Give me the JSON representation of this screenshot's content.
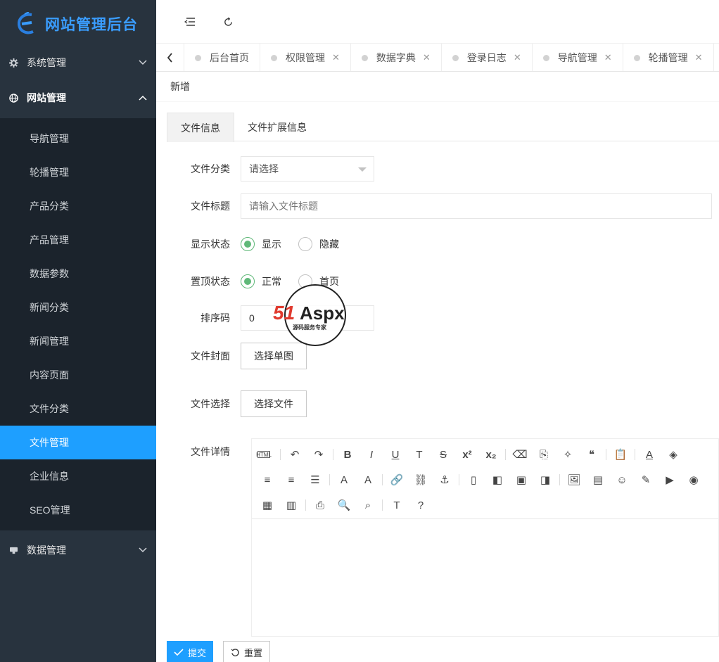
{
  "brand": {
    "title": "网站管理后台",
    "logo_icon": "e-logo-icon",
    "color": "#3a9dff"
  },
  "sidebar": {
    "groups": [
      {
        "label": "系统管理",
        "icon": "gear-icon",
        "open": false
      },
      {
        "label": "网站管理",
        "icon": "globe-icon",
        "open": true
      },
      {
        "label": "数据管理",
        "icon": "database-icon",
        "open": false
      }
    ],
    "items": [
      "导航管理",
      "轮播管理",
      "产品分类",
      "产品管理",
      "数据参数",
      "新闻分类",
      "新闻管理",
      "内容页面",
      "文件分类",
      "文件管理",
      "企业信息",
      "SEO管理"
    ],
    "active_item": "文件管理",
    "colors": {
      "bg": "#28333e",
      "submenu_bg": "#1b232c",
      "active": "#1e9fff"
    }
  },
  "header": {
    "collapse_icon": "menu-fold-icon",
    "refresh_icon": "refresh-icon"
  },
  "tabs": {
    "items": [
      {
        "label": "后台首页",
        "closable": false
      },
      {
        "label": "权限管理",
        "closable": true
      },
      {
        "label": "数据字典",
        "closable": true
      },
      {
        "label": "登录日志",
        "closable": true
      },
      {
        "label": "导航管理",
        "closable": true
      },
      {
        "label": "轮播管理",
        "closable": true
      }
    ],
    "close_glyph": "✕"
  },
  "page": {
    "title": "新增"
  },
  "form_tabs": [
    "文件信息",
    "文件扩展信息"
  ],
  "form": {
    "category_label": "文件分类",
    "category_value": "请选择",
    "title_label": "文件标题",
    "title_placeholder": "请输入文件标题",
    "status_label": "显示状态",
    "status_options": [
      "显示",
      "隐藏"
    ],
    "status_selected": "显示",
    "top_label": "置顶状态",
    "top_options": [
      "正常",
      "首页"
    ],
    "top_selected": "正常",
    "sort_label": "排序码",
    "sort_value": "0",
    "cover_label": "文件封面",
    "cover_button": "选择单图",
    "file_label": "文件选择",
    "file_button": "选择文件",
    "detail_label": "文件详情",
    "accent_color": "#5fb878"
  },
  "editor": {
    "tool_row1": [
      {
        "icon": "html-icon",
        "glyph": "HTML"
      },
      {
        "icon": "undo-icon",
        "glyph": "↶"
      },
      {
        "icon": "redo-icon",
        "glyph": "↷"
      },
      {
        "icon": "bold-icon",
        "glyph": "B"
      },
      {
        "icon": "italic-icon",
        "glyph": "I"
      },
      {
        "icon": "underline-icon",
        "glyph": "U"
      },
      {
        "icon": "textbox-icon",
        "glyph": "T"
      },
      {
        "icon": "strikethrough-icon",
        "glyph": "S"
      },
      {
        "icon": "superscript-icon",
        "glyph": "x²"
      },
      {
        "icon": "subscript-icon",
        "glyph": "x₂"
      },
      {
        "icon": "eraser-icon",
        "glyph": "⌫"
      },
      {
        "icon": "format-painter-icon",
        "glyph": "⎘"
      },
      {
        "icon": "magic-wand-icon",
        "glyph": "✧"
      },
      {
        "icon": "blockquote-icon",
        "glyph": "❝"
      },
      {
        "icon": "paste-icon",
        "glyph": "📋"
      },
      {
        "icon": "font-color-icon",
        "glyph": "A"
      },
      {
        "icon": "bg-color-icon",
        "glyph": "◈"
      }
    ],
    "tool_row2": [
      {
        "icon": "align-center-icon",
        "glyph": "≡"
      },
      {
        "icon": "align-right-icon",
        "glyph": "≡"
      },
      {
        "icon": "align-justify-icon",
        "glyph": "☰"
      },
      {
        "icon": "font-size-down-icon",
        "glyph": "A"
      },
      {
        "icon": "font-size-up-icon",
        "glyph": "A"
      },
      {
        "icon": "link-icon",
        "glyph": "🔗"
      },
      {
        "icon": "unlink-icon",
        "glyph": "⛓"
      },
      {
        "icon": "anchor-icon",
        "glyph": "⚓"
      },
      {
        "icon": "image-none-icon",
        "glyph": "▯"
      },
      {
        "icon": "image-left-icon",
        "glyph": "◧"
      },
      {
        "icon": "image-center-icon",
        "glyph": "▣"
      },
      {
        "icon": "image-right-icon",
        "glyph": "◨"
      },
      {
        "icon": "insert-image-icon",
        "glyph": "🖼"
      },
      {
        "icon": "insert-image-remote-icon",
        "glyph": "▤"
      },
      {
        "icon": "emoji-icon",
        "glyph": "☺"
      },
      {
        "icon": "scrawl-icon",
        "glyph": "✎"
      },
      {
        "icon": "video-icon",
        "glyph": "▶"
      },
      {
        "icon": "audio-icon",
        "glyph": "◉"
      }
    ],
    "tool_row3": [
      {
        "icon": "table-icon",
        "glyph": "▦"
      },
      {
        "icon": "table-merge-icon",
        "glyph": "▥"
      },
      {
        "icon": "print-icon",
        "glyph": "⎙"
      },
      {
        "icon": "preview-icon",
        "glyph": "🔍"
      },
      {
        "icon": "search-replace-icon",
        "glyph": "⌕"
      },
      {
        "icon": "template-icon",
        "glyph": "T"
      },
      {
        "icon": "help-icon",
        "glyph": "?"
      }
    ]
  },
  "footer": {
    "submit_label": "提交",
    "reset_label": "重置",
    "submit_icon": "check-icon",
    "reset_icon": "reset-icon"
  },
  "watermark": {
    "text": "51Aspx",
    "subtext": "源码服务专家"
  }
}
